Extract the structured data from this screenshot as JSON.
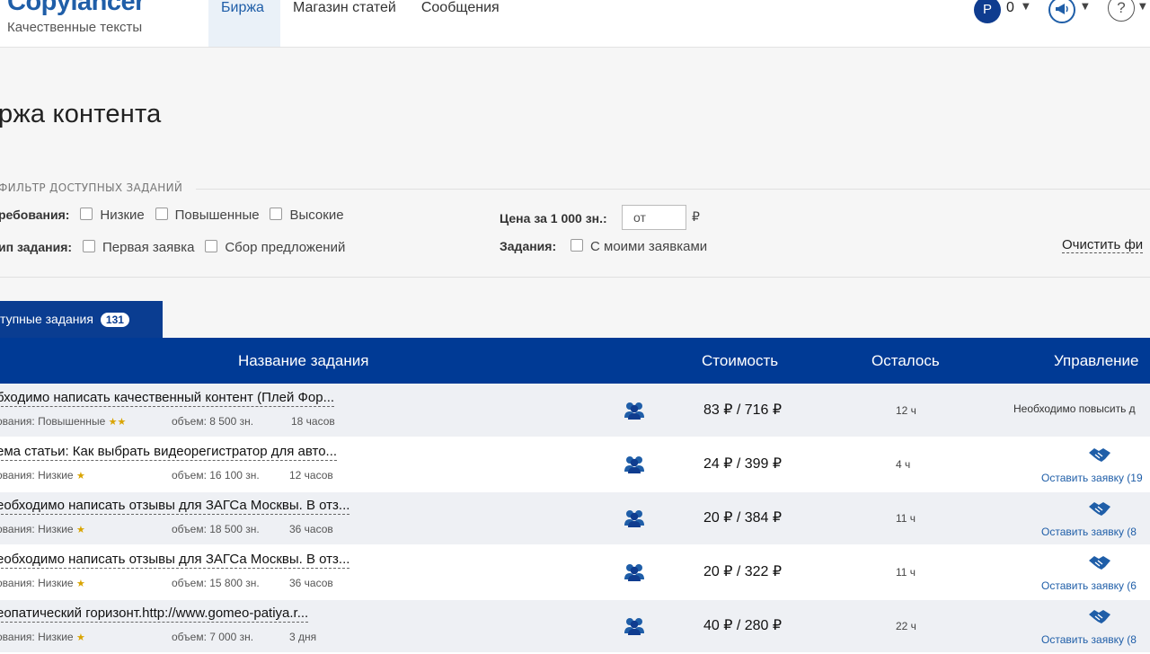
{
  "header": {
    "logo": "Copylancer",
    "logo_sub": "Качественные тексты",
    "nav": [
      "Биржа",
      "Магазин статей",
      "Сообщения"
    ],
    "balance_icon": "Р",
    "balance": "0",
    "help": "?"
  },
  "page": {
    "title": "ржа контента"
  },
  "filter": {
    "legend": "ФИЛЬТР ДОСТУПНЫХ ЗАДАНИЙ",
    "requirements_label": "ребования:",
    "requirements": [
      "Низкие",
      "Повышенные",
      "Высокие"
    ],
    "type_label": "ип задания:",
    "types": [
      "Первая заявка",
      "Сбор предложений"
    ],
    "price_label": "Цена за 1 000 зн.:",
    "price_placeholder": "от",
    "price_currency": "₽",
    "tasks_label": "Задания:",
    "tasks_option": "С моими заявками",
    "clear": "Очистить фи"
  },
  "tab": {
    "label": "тупные задания",
    "count": "131"
  },
  "table": {
    "headers": {
      "name": "Название задания",
      "cost": "Стоимость",
      "left": "Осталось",
      "manage": "Управление"
    },
    "rows": [
      {
        "title": "бходимо написать качественный контент (Плей Фор...",
        "req": "ования: Повышенные",
        "stars": "★★",
        "volume": "объем: 8 500 зн.",
        "time": "18 часов",
        "price": "83 ₽ / 716 ₽",
        "left": "12 ч",
        "manage": "Необходимо повысить д",
        "apply": ""
      },
      {
        "title": "ема статьи: Как выбрать видеорегистратор для авто...",
        "req": "ования: Низкие",
        "stars": "★",
        "volume": "объем: 16 100 зн.",
        "time": "12 часов",
        "price": "24 ₽ / 399 ₽",
        "left": "4 ч",
        "manage": "",
        "apply": "Оставить заявку (19"
      },
      {
        "title": "еобходимо написать отзывы для ЗАГСа Москвы. В отз...",
        "req": "ования: Низкие",
        "stars": "★",
        "volume": "объем: 18 500 зн.",
        "time": "36 часов",
        "price": "20 ₽ / 384 ₽",
        "left": "11 ч",
        "manage": "",
        "apply": "Оставить заявку (8"
      },
      {
        "title": "еобходимо написать отзывы для ЗАГСа Москвы. В отз...",
        "req": "ования: Низкие",
        "stars": "★",
        "volume": "объем: 15 800 зн.",
        "time": "36 часов",
        "price": "20 ₽ / 322 ₽",
        "left": "11 ч",
        "manage": "",
        "apply": "Оставить заявку (6"
      },
      {
        "title": "еопатический горизонт.http://www.gomeo-patiya.r...",
        "req": "ования: Низкие",
        "stars": "★",
        "volume": "объем: 7 000 зн.",
        "time": "3 дня",
        "price": "40 ₽ / 280 ₽",
        "left": "22 ч",
        "manage": "",
        "apply": "Оставить заявку (8"
      }
    ]
  },
  "colors": {
    "primary": "#003a95",
    "link": "#1f5ea8",
    "star": "#d9a400"
  }
}
